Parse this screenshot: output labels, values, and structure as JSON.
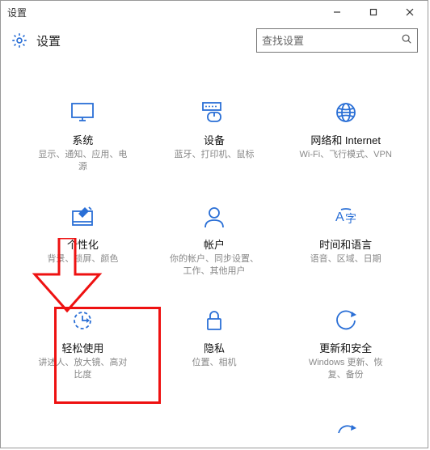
{
  "titlebar": {
    "title": "设置"
  },
  "header": {
    "title": "设置",
    "search_placeholder": "查找设置"
  },
  "tiles": {
    "system": {
      "title": "系统",
      "desc": "显示、通知、应用、电\n源"
    },
    "devices": {
      "title": "设备",
      "desc": "蓝牙、打印机、鼠标"
    },
    "network": {
      "title": "网络和 Internet",
      "desc": "Wi-Fi、飞行模式、VPN"
    },
    "personalize": {
      "title": "个性化",
      "desc": "背景、锁屏、颜色"
    },
    "accounts": {
      "title": "帐户",
      "desc": "你的帐户、同步设置、\n工作、其他用户"
    },
    "timelang": {
      "title": "时间和语言",
      "desc": "语音、区域、日期"
    },
    "ease": {
      "title": "轻松使用",
      "desc": "讲述人、放大镜、高对\n比度"
    },
    "privacy": {
      "title": "隐私",
      "desc": "位置、相机"
    },
    "update": {
      "title": "更新和安全",
      "desc": "Windows 更新、恢\n复、备份"
    }
  },
  "colors": {
    "accent": "#2a6fd6",
    "annotation": "#e11"
  }
}
